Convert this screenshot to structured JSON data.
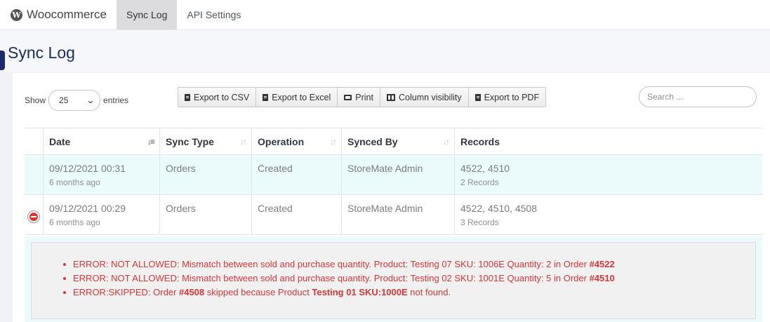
{
  "nav": {
    "brand": "Woocommerce",
    "brand_icon": "W",
    "tabs": [
      {
        "label": "Sync Log",
        "active": true
      },
      {
        "label": "API Settings",
        "active": false
      }
    ]
  },
  "page": {
    "title": "Sync Log"
  },
  "length_menu": {
    "prefix": "Show",
    "selected": "25",
    "suffix": "entries"
  },
  "buttons": {
    "csv": "Export to CSV",
    "excel": "Export to Excel",
    "print": "Print",
    "columns": "Column visibility",
    "pdf": "Export to PDF"
  },
  "search": {
    "placeholder": "Search ..."
  },
  "table": {
    "headers": {
      "date": "Date",
      "type": "Sync Type",
      "operation": "Operation",
      "by": "Synced By",
      "records": "Records"
    },
    "rows": [
      {
        "date": "09/12/2021 00:31",
        "ago": "6 months ago",
        "type": "Orders",
        "operation": "Created",
        "by": "StoreMate Admin",
        "records": "4522, 4510",
        "count": "2 Records",
        "expanded": false
      },
      {
        "date": "09/12/2021 00:29",
        "ago": "6 months ago",
        "type": "Orders",
        "operation": "Created",
        "by": "StoreMate Admin",
        "records": "4522, 4510, 4508",
        "count": "3 Records",
        "expanded": true
      }
    ]
  },
  "details": {
    "e1_text": "ERROR: NOT ALLOWED: Mismatch between sold and purchase quantity. Product: Testing 07 SKU: 1006E Quantity: 2 in Order ",
    "e1_order": "#4522",
    "e2_text": "ERROR: NOT ALLOWED: Mismatch between sold and purchase quantity. Product: Testing 02 SKU: 1001E Quantity: 5 in Order ",
    "e2_order": "#4510",
    "e3_a": "ERROR:SKIPPED: Order ",
    "e3_order": "#4508",
    "e3_b": " skipped because Product ",
    "e3_product": "Testing 01 SKU:1000E",
    "e3_c": " not found."
  },
  "colors": {
    "error": "#d63638",
    "title": "#1d2d5c",
    "highlight_row": "#ebfafb"
  }
}
